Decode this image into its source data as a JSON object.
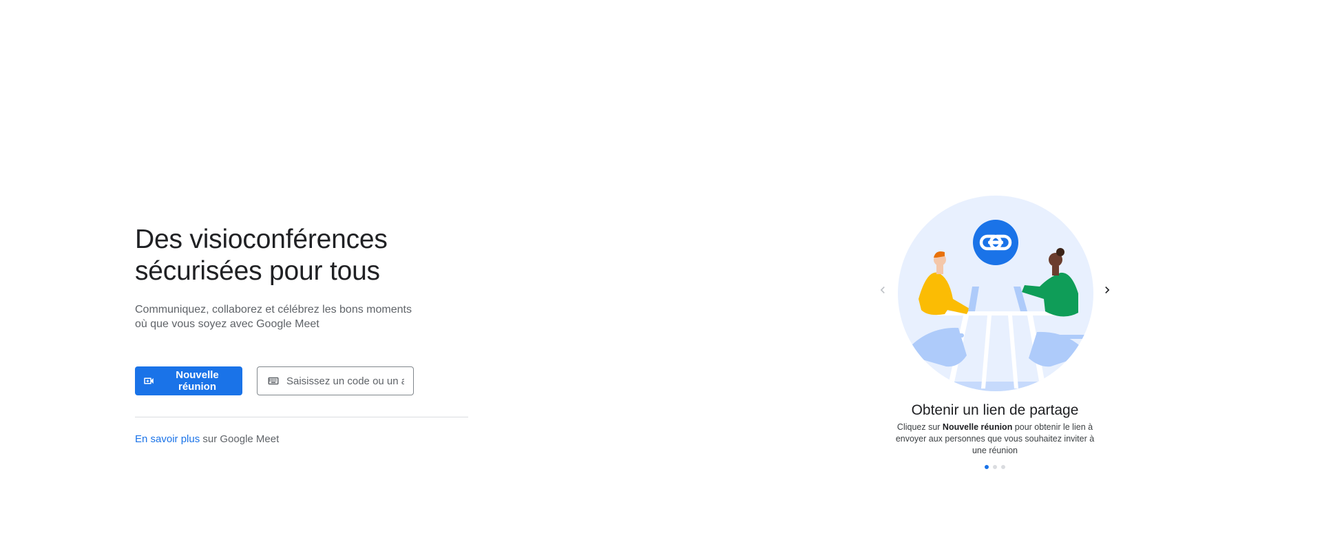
{
  "hero": {
    "headline_line1": "Des visioconférences",
    "headline_line2": "sécurisées pour tous",
    "subtitle_line1": "Communiquez, collaborez et célébrez les bons moments",
    "subtitle_line2": "où que vous soyez avec Google Meet"
  },
  "actions": {
    "new_meeting_label": "Nouvelle réunion",
    "new_meeting_icon": "video-add-icon",
    "code_input_placeholder": "Saisissez un code ou un alias",
    "code_input_value": "",
    "keyboard_icon": "keyboard-icon"
  },
  "learn_more": {
    "link_text": "En savoir plus",
    "suffix_text": " sur Google Meet"
  },
  "carousel": {
    "prev_icon": "chevron-left-icon",
    "next_icon": "chevron-right-icon",
    "slide_title": "Obtenir un lien de partage",
    "desc_prefix": "Cliquez sur ",
    "desc_bold": "Nouvelle réunion",
    "desc_suffix": " pour obtenir le lien à envoyer aux personnes que vous souhaitez inviter à une réunion",
    "link_badge_icon": "link-icon",
    "slide_count": 3,
    "active_index": 0
  },
  "colors": {
    "primary": "#1a73e8",
    "text": "#202124",
    "secondary_text": "#5f6368",
    "divider": "#dadce0"
  }
}
